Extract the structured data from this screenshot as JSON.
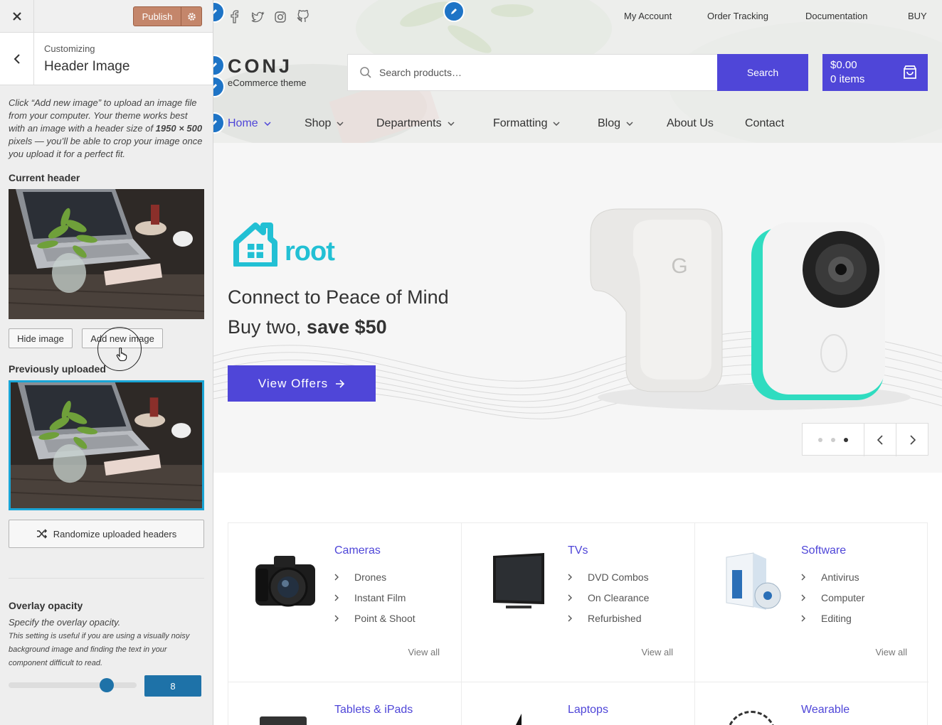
{
  "customizer": {
    "publish_label": "Publish",
    "breadcrumb": "Customizing",
    "section_title": "Header Image",
    "description_parts": [
      "Click “Add new image” to upload an image file from your computer. Your theme works best with an image with a header size of ",
      "1950 × 500",
      " pixels — you’ll be able to crop your image once you upload it for a perfect fit."
    ],
    "current_header_label": "Current header",
    "hide_image_label": "Hide image",
    "add_new_image_label": "Add new image",
    "previously_uploaded_label": "Previously uploaded",
    "randomize_label": "Randomize uploaded headers",
    "overlay_label": "Overlay opacity",
    "overlay_desc": "Specify the overlay opacity.",
    "overlay_note": "This setting is useful if you are using a visually noisy background image and finding the text in your component difficult to read.",
    "overlay_value": "8",
    "overlay_fraction": 0.8
  },
  "site": {
    "top_links": [
      "My Account",
      "Order Tracking",
      "Documentation",
      "BUY"
    ],
    "social_icons": [
      "facebook-icon",
      "twitter-icon",
      "instagram-icon",
      "github-icon"
    ],
    "logo": "CONJ",
    "logo_sub": "eCommerce theme",
    "search_placeholder": "Search products…",
    "search_label": "Search",
    "cart_amount": "$0.00",
    "cart_items": "0 items",
    "nav": [
      "Home",
      "Shop",
      "Departments",
      "Formatting",
      "Blog",
      "About Us",
      "Contact"
    ],
    "slider": {
      "brand": "root",
      "title": "Connect to Peace of Mind",
      "sub_prefix": "Buy two, ",
      "sub_bold": "save $50",
      "cta": "View Offers",
      "dots": 3,
      "active_dot": 3
    },
    "categories": [
      {
        "title": "Cameras",
        "items": [
          "Drones",
          "Instant Film",
          "Point & Shoot"
        ],
        "view_all": "View all"
      },
      {
        "title": "TVs",
        "items": [
          "DVD Combos",
          "On Clearance",
          "Refurbished"
        ],
        "view_all": "View all"
      },
      {
        "title": "Software",
        "items": [
          "Antivirus",
          "Computer",
          "Editing"
        ],
        "view_all": "View all"
      }
    ],
    "categories_row2": [
      "Tablets & iPads",
      "Laptops",
      "Wearable"
    ]
  }
}
